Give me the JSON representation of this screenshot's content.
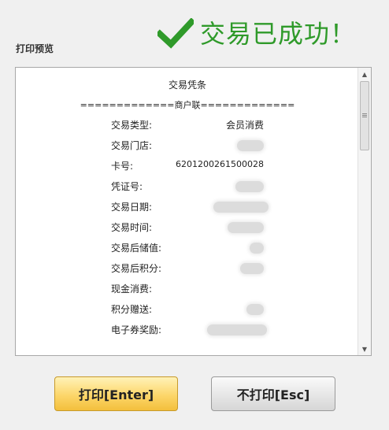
{
  "header": {
    "success_text": "交易已成功！"
  },
  "preview": {
    "label": "打印预览"
  },
  "receipt": {
    "title": "交易凭条",
    "divider": "=============商户联=============",
    "rows": [
      {
        "label": "交易类型:",
        "value": "会员消费"
      },
      {
        "label": "交易门店:",
        "value": ""
      },
      {
        "label": "卡号:",
        "value": "6201200261500028"
      },
      {
        "label": "凭证号:",
        "value": ""
      },
      {
        "label": "交易日期:",
        "value": ""
      },
      {
        "label": "交易时间:",
        "value": ""
      },
      {
        "label": "交易后储值:",
        "value": ""
      },
      {
        "label": "交易后积分:",
        "value": ""
      },
      {
        "label": "现金消费:",
        "value": ""
      },
      {
        "label": "积分赠送:",
        "value": ""
      },
      {
        "label": "电子券奖励:",
        "value": ""
      }
    ]
  },
  "buttons": {
    "print": "打印[Enter]",
    "no_print": "不打印[Esc]"
  },
  "colors": {
    "success_green": "#2f9a2a",
    "print_button": "#fcd66a"
  },
  "icons": {
    "success": "checkmark-icon"
  }
}
